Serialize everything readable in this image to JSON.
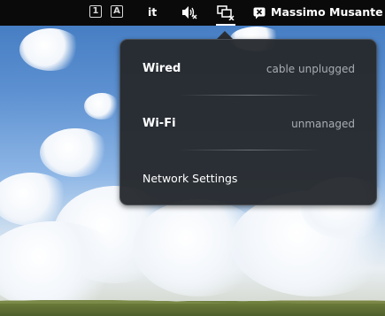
{
  "topbar": {
    "indicator1": "1",
    "indicatorA": "A",
    "keyboard_layout": "it",
    "volume_icon": "speaker-muted-icon",
    "network_icon": "network-wired-disconnected-icon",
    "user_icon": "chat-offline-icon",
    "user_name": "Massimo Musante"
  },
  "network_menu": {
    "wired": {
      "label": "Wired",
      "status": "cable unplugged"
    },
    "wifi": {
      "label": "Wi-Fi",
      "status": "unmanaged"
    },
    "settings_label": "Network Settings"
  },
  "colors": {
    "bar": "#0a0a0a",
    "popover_bg": "#272a2e",
    "status_text": "#a9adb2"
  }
}
